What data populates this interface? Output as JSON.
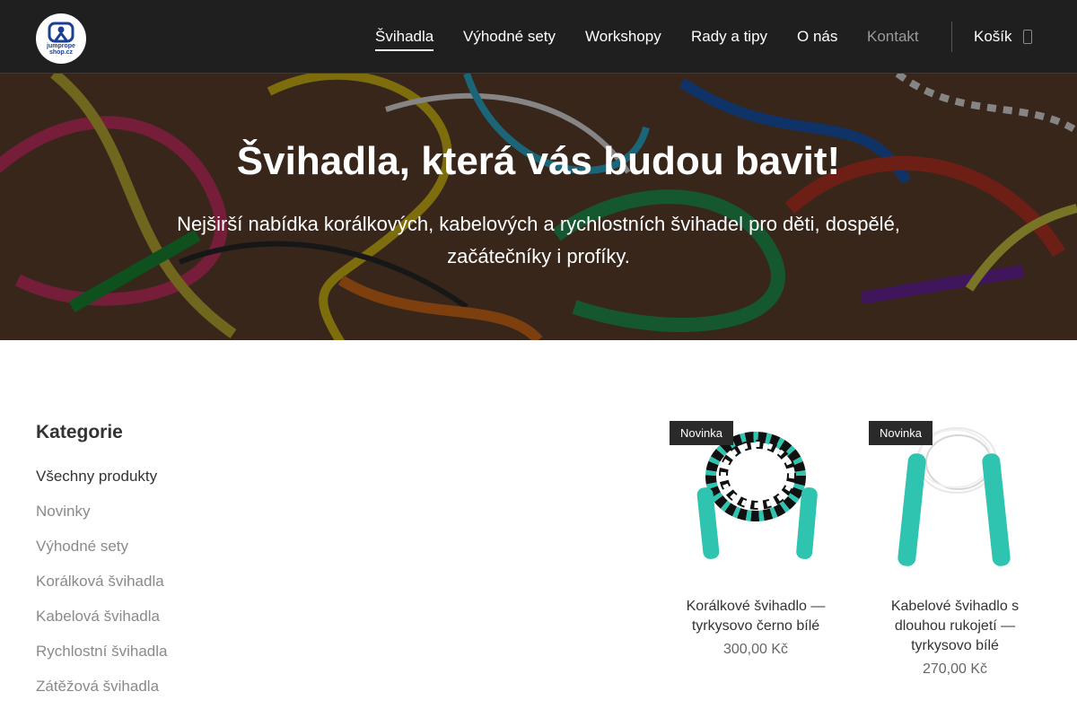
{
  "brand": {
    "logo_text_line1": "jumprope",
    "logo_text_line2": "shop.cz",
    "logo_color": "#1c3f94"
  },
  "nav": {
    "items": [
      {
        "label": "Švihadla",
        "active": true
      },
      {
        "label": "Výhodné sety"
      },
      {
        "label": "Workshopy"
      },
      {
        "label": "Rady a tipy"
      },
      {
        "label": "O nás"
      },
      {
        "label": "Kontakt"
      }
    ],
    "cart_label": "Košík",
    "cart_icon": "bag-icon"
  },
  "hero": {
    "title": "Švihadla, která vás budou bavit!",
    "subtitle": "Nejširší nabídka korálkových, kabelových a rychlostních švihadel pro děti, dospělé, začátečníky i profíky."
  },
  "sidebar": {
    "heading": "Kategorie",
    "categories": [
      "Všechny produkty",
      "Novinky",
      "Výhodné sety",
      "Korálková švihadla",
      "Kabelová švihadla",
      "Rychlostní švihadla",
      "Zátěžová švihadla"
    ]
  },
  "products": [
    {
      "badge": "Novinka",
      "name": "Korálkové švihadlo — tyrkysovo černo bílé",
      "price": "300,00 Kč",
      "handle_color": "#2ec4b0"
    },
    {
      "badge": "Novinka",
      "name": "Kabelové švihadlo s dlouhou rukojetí — tyrkysovo bílé",
      "price": "270,00 Kč",
      "handle_color": "#2ec4b0"
    }
  ]
}
